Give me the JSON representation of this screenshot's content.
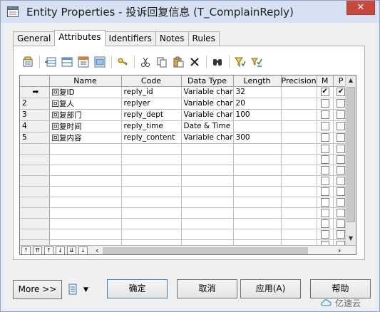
{
  "window": {
    "title": "Entity Properties - 投诉回复信息 (T_ComplainReply)",
    "close_glyph": "✕"
  },
  "tabs": [
    {
      "label": "General",
      "active": false
    },
    {
      "label": "Attributes",
      "active": true
    },
    {
      "label": "Identifiers",
      "active": false
    },
    {
      "label": "Notes",
      "active": false
    },
    {
      "label": "Rules",
      "active": false
    }
  ],
  "toolbar": {
    "icons": [
      "properties-icon",
      "insert-row-icon",
      "add-row-icon",
      "add-attributes-icon",
      "reuse-attributes-icon",
      "key-icon",
      "cut-icon",
      "copy-icon",
      "paste-icon",
      "delete-icon",
      "find-icon",
      "filter-icon",
      "customize-columns-icon"
    ]
  },
  "grid": {
    "columns": [
      "",
      "Name",
      "Code",
      "Data Type",
      "Length",
      "Precision",
      "M",
      "P"
    ],
    "current_row_marker": "➡",
    "rows": [
      {
        "num": "",
        "name": "回复ID",
        "code": "reply_id",
        "type": "Variable char",
        "length": "32",
        "precision": "",
        "m": true,
        "p": true
      },
      {
        "num": "2",
        "name": "回复人",
        "code": "replyer",
        "type": "Variable char",
        "length": "20",
        "precision": "",
        "m": false,
        "p": false
      },
      {
        "num": "3",
        "name": "回复部门",
        "code": "reply_dept",
        "type": "Variable char",
        "length": "100",
        "precision": "",
        "m": false,
        "p": false
      },
      {
        "num": "4",
        "name": "回复时间",
        "code": "reply_time",
        "type": "Date & Time",
        "length": "",
        "precision": "",
        "m": false,
        "p": false
      },
      {
        "num": "5",
        "name": "回复内容",
        "code": "reply_content",
        "type": "Variable char",
        "length": "300",
        "precision": "",
        "m": false,
        "p": false
      }
    ],
    "empty_rows": 10,
    "nav_buttons": [
      "⤒",
      "⇈",
      "↑",
      "↓",
      "⇊",
      "⤓"
    ]
  },
  "buttons": {
    "more": "More >>",
    "ok": "确定",
    "cancel": "取消",
    "apply": "应用(A)",
    "help": "帮助"
  },
  "watermark": "亿速云"
}
